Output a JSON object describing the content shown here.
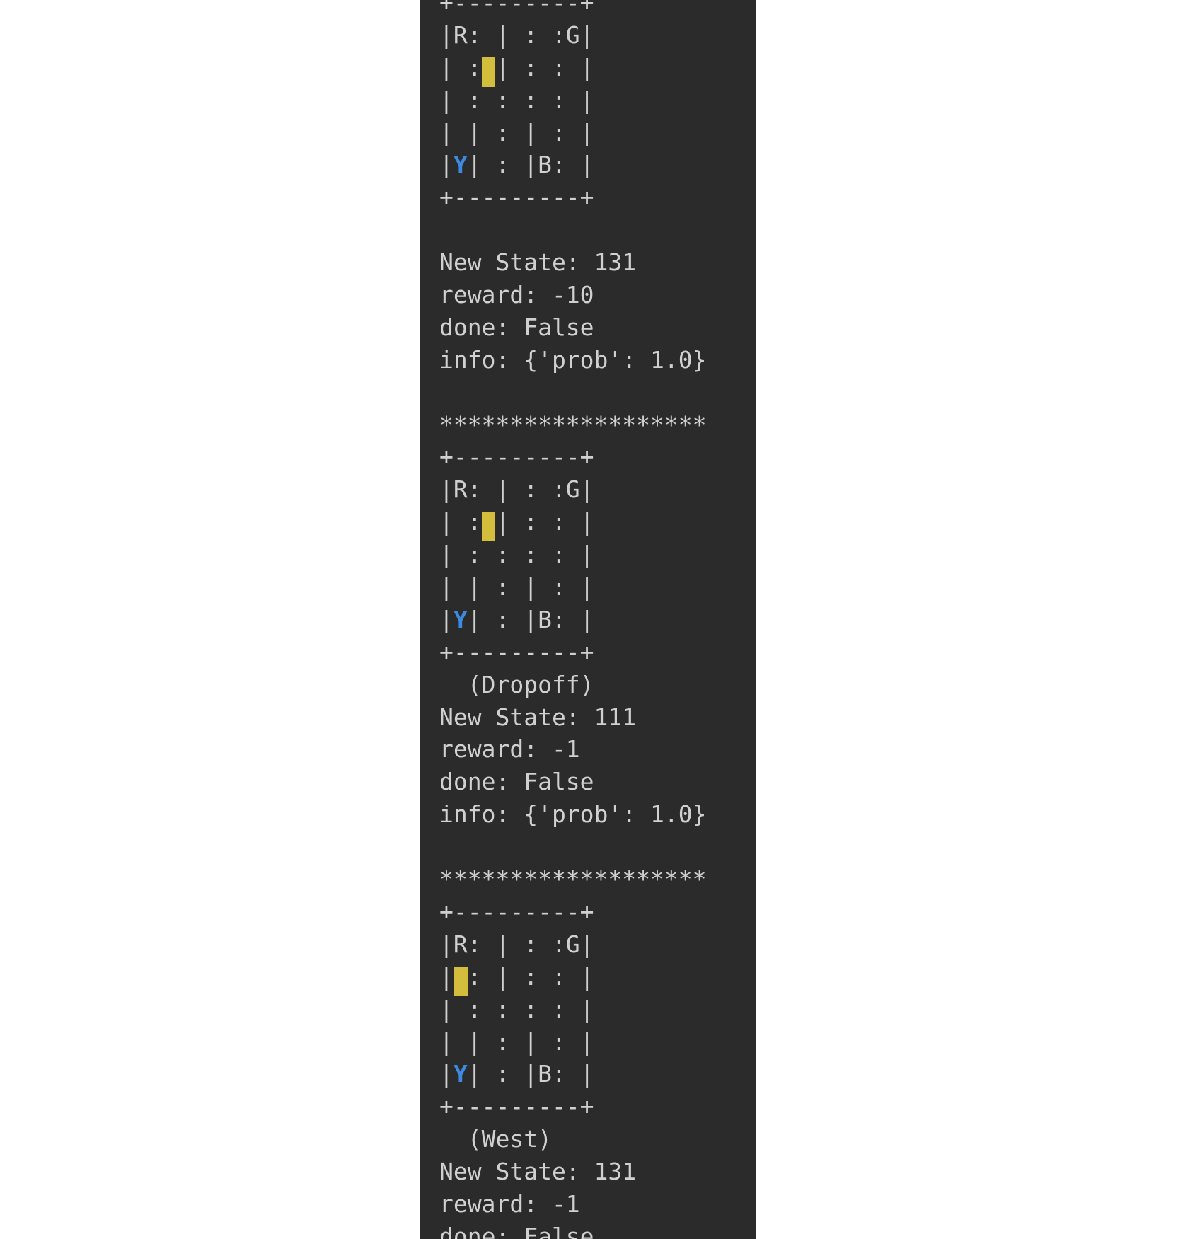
{
  "colors": {
    "background": "#2b2b2b",
    "text": "#d0d0d0",
    "taxi": "#d4bd3c",
    "destination": "#3d8be0"
  },
  "lines": [
    {
      "text": "+---------+"
    },
    {
      "segments": [
        {
          "t": "|R: | : :G|"
        }
      ]
    },
    {
      "segments": [
        {
          "t": "| :"
        },
        {
          "t": " ",
          "style": "taxi"
        },
        {
          "t": "| : : |"
        }
      ]
    },
    {
      "text": "| : : : : |"
    },
    {
      "text": "| | : | : |"
    },
    {
      "segments": [
        {
          "t": "|"
        },
        {
          "t": "Y",
          "style": "dest"
        },
        {
          "t": "| : |B: |"
        }
      ]
    },
    {
      "text": "+---------+"
    },
    {
      "text": ""
    },
    {
      "text": "New State: 131"
    },
    {
      "text": "reward: -10"
    },
    {
      "text": "done: False"
    },
    {
      "text": "info: {'prob': 1.0}"
    },
    {
      "text": ""
    },
    {
      "text": "*******************"
    },
    {
      "text": "+---------+"
    },
    {
      "segments": [
        {
          "t": "|R: | : :G|"
        }
      ]
    },
    {
      "segments": [
        {
          "t": "| :"
        },
        {
          "t": " ",
          "style": "taxi"
        },
        {
          "t": "| : : |"
        }
      ]
    },
    {
      "text": "| : : : : |"
    },
    {
      "text": "| | : | : |"
    },
    {
      "segments": [
        {
          "t": "|"
        },
        {
          "t": "Y",
          "style": "dest"
        },
        {
          "t": "| : |B: |"
        }
      ]
    },
    {
      "text": "+---------+"
    },
    {
      "text": "  (Dropoff)"
    },
    {
      "text": "New State: 111"
    },
    {
      "text": "reward: -1"
    },
    {
      "text": "done: False"
    },
    {
      "text": "info: {'prob': 1.0}"
    },
    {
      "text": ""
    },
    {
      "text": "*******************"
    },
    {
      "text": "+---------+"
    },
    {
      "segments": [
        {
          "t": "|R: | : :G|"
        }
      ]
    },
    {
      "segments": [
        {
          "t": "|"
        },
        {
          "t": " ",
          "style": "taxi"
        },
        {
          "t": ": | : : |"
        }
      ]
    },
    {
      "text": "| : : : : |"
    },
    {
      "text": "| | : | : |"
    },
    {
      "segments": [
        {
          "t": "|"
        },
        {
          "t": "Y",
          "style": "dest"
        },
        {
          "t": "| : |B: |"
        }
      ]
    },
    {
      "text": "+---------+"
    },
    {
      "text": "  (West)"
    },
    {
      "text": "New State: 131"
    },
    {
      "text": "reward: -1"
    },
    {
      "text": "done: False"
    }
  ]
}
